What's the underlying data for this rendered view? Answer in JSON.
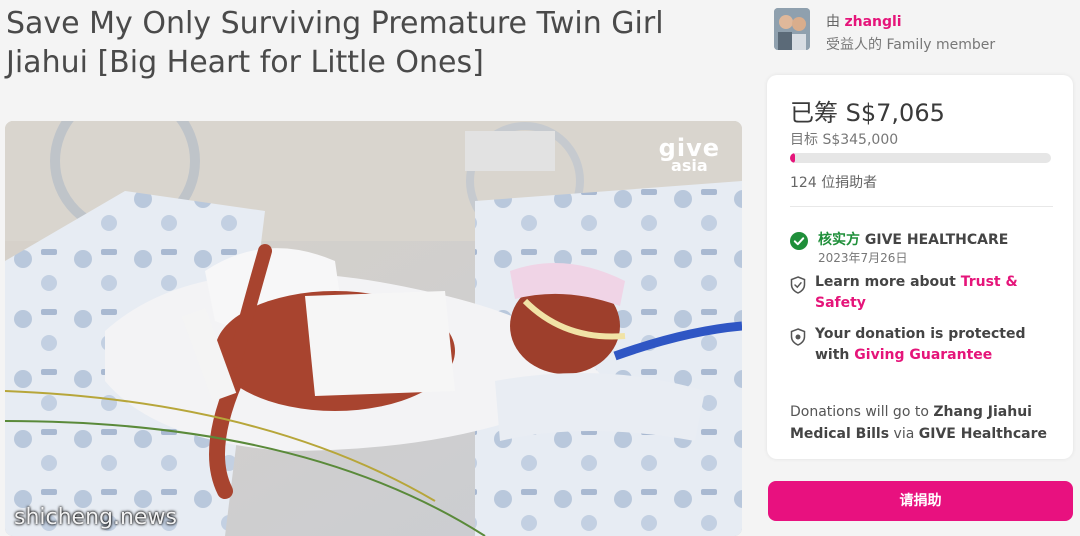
{
  "campaign": {
    "title": "Save My Only Surviving Premature Twin Girl Jiahui [Big Heart for Little Ones]",
    "photo_brand_line1": "give",
    "photo_brand_line2": "asia",
    "photo_watermark": "shicheng.news"
  },
  "organizer": {
    "by_prefix": "由",
    "name": "zhangli",
    "relation": "受益人的 Family member"
  },
  "stats": {
    "raised_label": "已筹",
    "raised_amount": "S$7,065",
    "goal_label": "目标",
    "goal_amount": "S$345,000",
    "progress_fraction": 0.02,
    "donor_count": "124",
    "donor_suffix": "位捐助者"
  },
  "verification": {
    "label": "核实方",
    "org": "GIVE HEALTHCARE",
    "date": "2023年7月26日"
  },
  "trust": {
    "text": "Learn more about",
    "link": "Trust & Safety"
  },
  "guarantee": {
    "text": "Your donation is protected with",
    "link": "Giving Guarantee"
  },
  "destination": {
    "prefix": "Donations will go to",
    "recipient": "Zhang Jiahui Medical Bills",
    "via": "via",
    "partner": "GIVE Healthcare"
  },
  "donate_button": "请捐助",
  "colors": {
    "accent": "#e5157a",
    "verified": "#1f8f3a",
    "progress_track": "#e6e6e6"
  },
  "icons": {
    "verified": "check-circle-icon",
    "trust": "shield-check-icon",
    "guarantee": "shield-icon"
  }
}
